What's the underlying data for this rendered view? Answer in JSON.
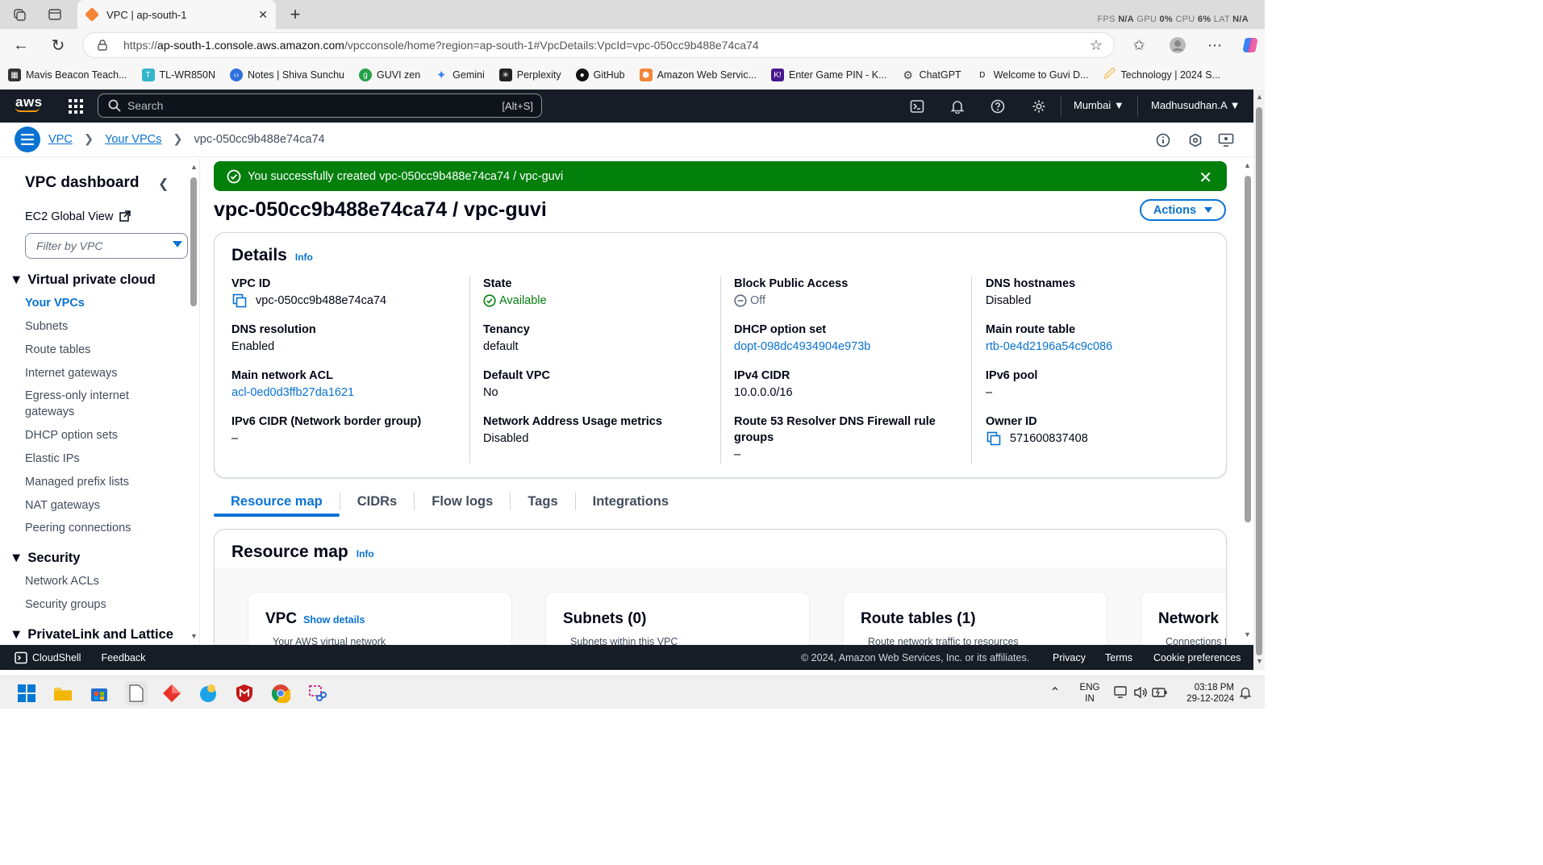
{
  "browser": {
    "tab_title": "VPC | ap-south-1",
    "perf": {
      "fps_label": "FPS",
      "fps": "N/A",
      "gpu_label": "GPU",
      "gpu": "0%",
      "cpu_label": "CPU",
      "cpu": "6%",
      "lat_label": "LAT",
      "lat": "N/A"
    },
    "url_prefix": "https://",
    "url_host": "ap-south-1.console.aws.amazon.com",
    "url_path": "/vpcconsole/home?region=ap-south-1#VpcDetails:VpcId=vpc-050cc9b488e74ca74",
    "bookmarks": [
      {
        "label": "Mavis Beacon Teach...",
        "color": "#333333"
      },
      {
        "label": "TL-WR850N",
        "color": "#35b5c9"
      },
      {
        "label": "Notes | Shiva Sunchu",
        "color": "#2f6fde"
      },
      {
        "label": "GUVI zen",
        "color": "#24a148"
      },
      {
        "label": "Gemini",
        "color": "#3b82f6"
      },
      {
        "label": "Perplexity",
        "color": "#222222"
      },
      {
        "label": "GitHub",
        "color": "#111111"
      },
      {
        "label": "Amazon Web Servic...",
        "color": "#f58536"
      },
      {
        "label": "Enter Game PIN - K...",
        "color": "#46178f"
      },
      {
        "label": "ChatGPT",
        "color": "#555555"
      },
      {
        "label": "Welcome to Guvi D...",
        "color": "#ffffff"
      },
      {
        "label": "Technology | 2024 S...",
        "color": "#f5a623"
      }
    ]
  },
  "aws": {
    "logo": "aws",
    "search_placeholder": "Search",
    "search_shortcut": "[Alt+S]",
    "region": "Mumbai",
    "user": "Madhusudhan.A"
  },
  "breadcrumb": {
    "items": [
      "VPC",
      "Your VPCs"
    ],
    "current": "vpc-050cc9b488e74ca74"
  },
  "sidebar": {
    "title": "VPC dashboard",
    "ec2_global": "EC2 Global View",
    "filter_placeholder": "Filter by VPC",
    "sections": [
      {
        "title": "Virtual private cloud",
        "items": [
          "Your VPCs",
          "Subnets",
          "Route tables",
          "Internet gateways",
          "Egress-only internet",
          "gateways",
          "DHCP option sets",
          "Elastic IPs",
          "Managed prefix lists",
          "NAT gateways",
          "Peering connections"
        ]
      },
      {
        "title": "Security",
        "items": [
          "Network ACLs",
          "Security groups"
        ]
      },
      {
        "title": "PrivateLink and Lattice",
        "items": []
      }
    ]
  },
  "flash": {
    "message": "You successfully created vpc-050cc9b488e74ca74 / vpc-guvi"
  },
  "page": {
    "title": "vpc-050cc9b488e74ca74 / vpc-guvi",
    "actions": "Actions"
  },
  "details": {
    "title": "Details",
    "info": "Info",
    "fields": {
      "vpc_id": {
        "k": "VPC ID",
        "v": "vpc-050cc9b488e74ca74"
      },
      "state": {
        "k": "State",
        "v": "Available"
      },
      "bpa": {
        "k": "Block Public Access",
        "v": "Off"
      },
      "dns_hostnames": {
        "k": "DNS hostnames",
        "v": "Disabled"
      },
      "dns_resolution": {
        "k": "DNS resolution",
        "v": "Enabled"
      },
      "tenancy": {
        "k": "Tenancy",
        "v": "default"
      },
      "dhcp": {
        "k": "DHCP option set",
        "v": "dopt-098dc4934904e973b"
      },
      "main_rt": {
        "k": "Main route table",
        "v": "rtb-0e4d2196a54c9c086"
      },
      "main_acl": {
        "k": "Main network ACL",
        "v": "acl-0ed0d3ffb27da1621"
      },
      "default_vpc": {
        "k": "Default VPC",
        "v": "No"
      },
      "ipv4": {
        "k": "IPv4 CIDR",
        "v": "10.0.0.0/16"
      },
      "ipv6_pool": {
        "k": "IPv6 pool",
        "v": "–"
      },
      "ipv6_cidr": {
        "k": "IPv6 CIDR (Network border group)",
        "v": "–"
      },
      "nau": {
        "k": "Network Address Usage metrics",
        "v": "Disabled"
      },
      "r53_a": {
        "k": "Route 53 Resolver DNS Firewall rule",
        "v": "–"
      },
      "r53_b": {
        "k": "groups",
        "v": ""
      },
      "owner": {
        "k": "Owner ID",
        "v": "571600837408"
      }
    }
  },
  "tabs": [
    "Resource map",
    "CIDRs",
    "Flow logs",
    "Tags",
    "Integrations"
  ],
  "resource_map": {
    "title": "Resource map",
    "info": "Info",
    "cards": [
      {
        "title": "VPC",
        "link": "Show details",
        "sub": "Your AWS virtual network"
      },
      {
        "title": "Subnets (0)",
        "link": "",
        "sub": "Subnets within this VPC"
      },
      {
        "title": "Route tables (1)",
        "link": "",
        "sub": "Route network traffic to resources"
      },
      {
        "title": "Network",
        "link": "",
        "sub": "Connections t"
      }
    ]
  },
  "footer": {
    "cloudshell": "CloudShell",
    "feedback": "Feedback",
    "copyright": "© 2024, Amazon Web Services, Inc. or its affiliates.",
    "privacy": "Privacy",
    "terms": "Terms",
    "cookies": "Cookie preferences"
  },
  "taskbar": {
    "lang1": "ENG",
    "lang2": "IN",
    "time": "03:18 PM",
    "date": "29-12-2024"
  }
}
